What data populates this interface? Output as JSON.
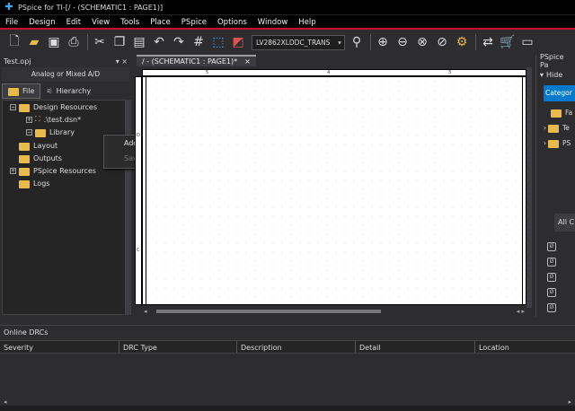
{
  "window": {
    "title": "PSpice for TI-[/ - (SCHEMATIC1 : PAGE1)]"
  },
  "menu": [
    "File",
    "Design",
    "Edit",
    "View",
    "Tools",
    "Place",
    "PSpice",
    "Options",
    "Window",
    "Help"
  ],
  "toolbar": {
    "part_value": "LV2862XLDDC_TRANS"
  },
  "project": {
    "panel_title": "Test.opj",
    "mode": "Analog or Mixed A/D",
    "tabs": [
      "File",
      "Hierarchy"
    ],
    "tree": [
      {
        "label": "Design Resources"
      },
      {
        "label": ".\\test.dsn*"
      },
      {
        "label": "Library"
      },
      {
        "label": "Layout"
      },
      {
        "label": "Outputs"
      },
      {
        "label": "PSpice Resources"
      },
      {
        "label": "Logs"
      }
    ]
  },
  "context_menu": {
    "items": [
      "Add File",
      "Save As..."
    ]
  },
  "document": {
    "tab_label": "/ - (SCHEMATIC1 : PAGE1)*",
    "ruler_top": [
      "5",
      "4",
      "3"
    ],
    "ruler_left": [
      "D",
      "C"
    ]
  },
  "right_panel": {
    "title": "PSpice Pa",
    "hide": "Hide",
    "category": "Categor",
    "tree": [
      "Fa",
      "Te",
      "PS"
    ],
    "all": "All C"
  },
  "drc": {
    "title": "Online DRCs",
    "columns": [
      "Severity",
      "DRC Type",
      "Description",
      "Detail",
      "Location"
    ]
  },
  "icons": {
    "brand_accent": "#c8102e",
    "folder_color": "#e8b94b"
  }
}
